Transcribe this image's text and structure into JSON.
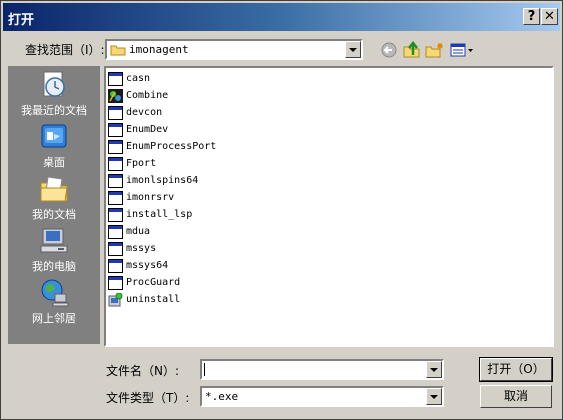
{
  "dialog": {
    "title": "打开",
    "help_label": "?",
    "close_label": "✕"
  },
  "lookin": {
    "label": "查找范围（I）:",
    "value": "imonagent"
  },
  "toolbar": {
    "back_icon": "back-arrow-icon",
    "up_icon": "up-folder-icon",
    "new_folder_icon": "new-folder-icon",
    "view_icon": "view-menu-icon"
  },
  "places": [
    {
      "label": "我最近的文档",
      "icon": "recent-documents-icon"
    },
    {
      "label": "桌面",
      "icon": "desktop-icon"
    },
    {
      "label": "我的文档",
      "icon": "my-documents-icon"
    },
    {
      "label": "我的电脑",
      "icon": "my-computer-icon"
    },
    {
      "label": "网上邻居",
      "icon": "network-places-icon"
    }
  ],
  "files": [
    {
      "name": "casn",
      "icon": "application-icon"
    },
    {
      "name": "Combine",
      "icon": "combine-app-icon"
    },
    {
      "name": "devcon",
      "icon": "application-icon"
    },
    {
      "name": "EnumDev",
      "icon": "application-icon"
    },
    {
      "name": "EnumProcessPort",
      "icon": "application-icon"
    },
    {
      "name": "Fport",
      "icon": "application-icon"
    },
    {
      "name": "imonlspins64",
      "icon": "application-icon"
    },
    {
      "name": "imonrsrv",
      "icon": "application-icon"
    },
    {
      "name": "install_lsp",
      "icon": "application-icon"
    },
    {
      "name": "mdua",
      "icon": "application-icon"
    },
    {
      "name": "mssys",
      "icon": "application-icon"
    },
    {
      "name": "mssys64",
      "icon": "application-icon"
    },
    {
      "name": "ProcGuard",
      "icon": "application-icon"
    },
    {
      "name": "uninstall",
      "icon": "uninstall-icon"
    }
  ],
  "filename": {
    "label": "文件名（N）:",
    "value": ""
  },
  "filetype": {
    "label": "文件类型（T）:",
    "value": "*.exe"
  },
  "buttons": {
    "open_label": "打开（O）",
    "cancel_label": "取消"
  }
}
